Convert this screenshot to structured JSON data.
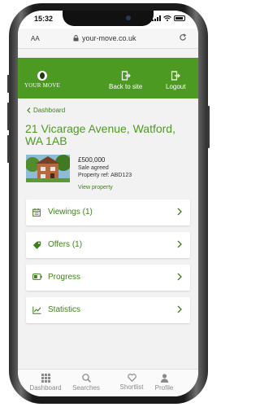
{
  "statusbar": {
    "time": "15:32"
  },
  "browser": {
    "aa": "AA",
    "url": "your-move.co.uk"
  },
  "header": {
    "logo_text": "YOUR MOVE",
    "back_to_site": "Back to site",
    "logout": "Logout"
  },
  "breadcrumb": {
    "label": "Dashboard"
  },
  "property": {
    "address": "21 Vicarage Avenue, Watford, WA 1AB",
    "price": "£500,000",
    "status": "Sale agreed",
    "ref": "Property ref: ABD123",
    "view_link": "View property"
  },
  "cards": [
    {
      "label": "Viewings (1)",
      "icon": "calendar-icon"
    },
    {
      "label": "Offers (1)",
      "icon": "tag-icon"
    },
    {
      "label": "Progress",
      "icon": "battery-icon"
    },
    {
      "label": "Statistics",
      "icon": "chart-icon"
    }
  ],
  "tabs": [
    {
      "label": "Dashboard",
      "icon": "grid-icon"
    },
    {
      "label": "Searches",
      "icon": "search-icon"
    },
    {
      "label": "Shortlist",
      "icon": "heart-icon"
    },
    {
      "label": "Profile",
      "icon": "person-icon"
    }
  ],
  "colors": {
    "brand_green": "#4d9a22",
    "text_green": "#3f7f1a"
  }
}
